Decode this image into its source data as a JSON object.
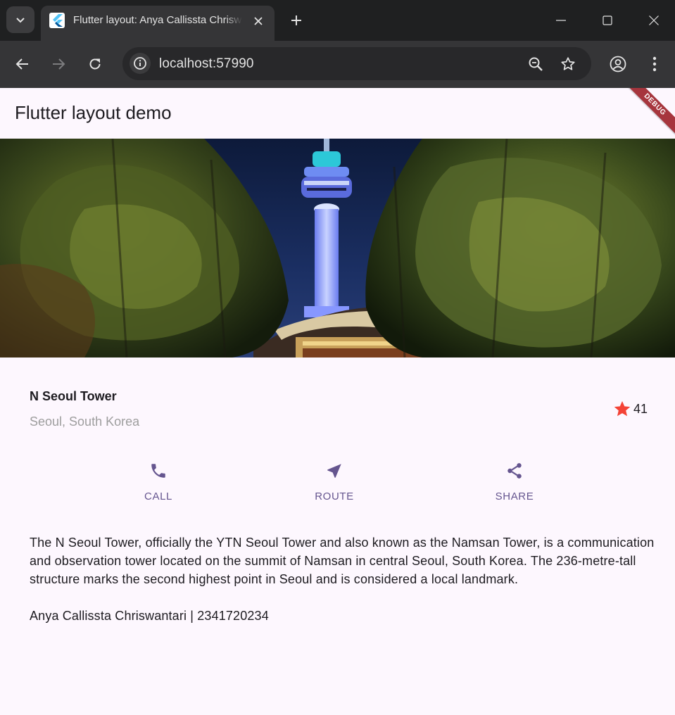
{
  "browser": {
    "tab_title": "Flutter layout: Anya Callissta Chriswantari",
    "url": "localhost:57990"
  },
  "app": {
    "title": "Flutter layout demo",
    "debug_banner": "DEBUG"
  },
  "place": {
    "name": "N Seoul Tower",
    "location": "Seoul, South Korea",
    "rating": "41"
  },
  "actions": [
    {
      "label": "CALL",
      "icon": "phone-icon"
    },
    {
      "label": "ROUTE",
      "icon": "near-me-icon"
    },
    {
      "label": "SHARE",
      "icon": "share-icon"
    }
  ],
  "description": "The N Seoul Tower, officially the YTN Seoul Tower and also known as the Namsan Tower, is a communication and observation tower located on the summit of Namsan in central Seoul, South Korea. The 236-metre-tall structure marks the second highest point in Seoul and is considered a local landmark.",
  "author": "Anya Callissta Chriswantari | 2341720234",
  "colors": {
    "accent": "#65558f",
    "star": "#f44336",
    "background": "#fdf7fe"
  }
}
